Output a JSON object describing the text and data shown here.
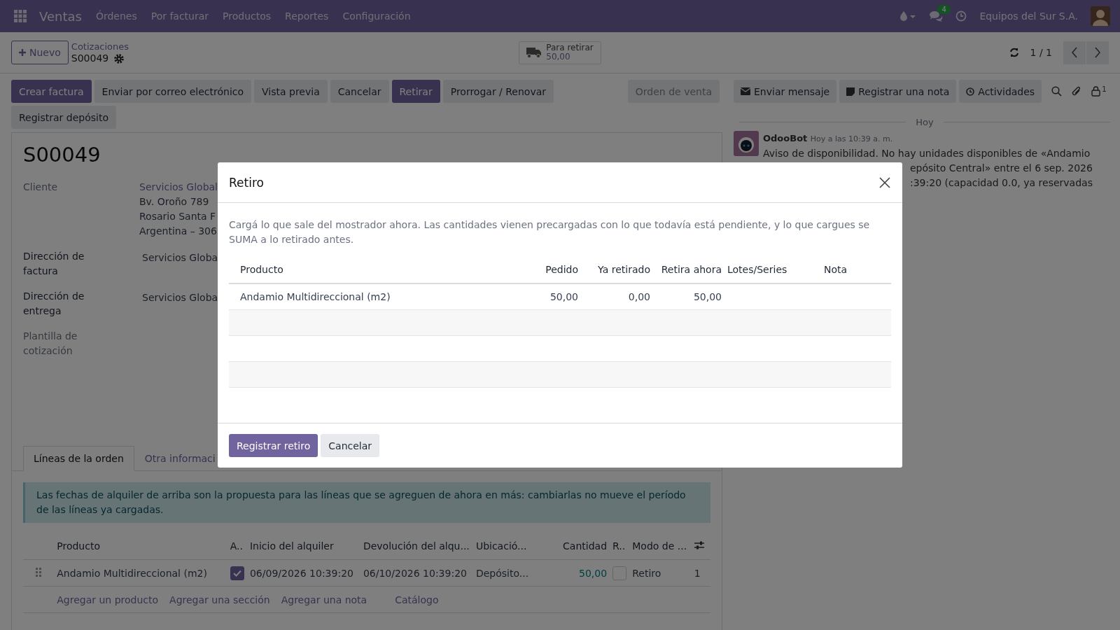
{
  "navbar": {
    "app": "Ventas",
    "menu": [
      "Órdenes",
      "Por facturar",
      "Productos",
      "Reportes",
      "Configuración"
    ],
    "messages_badge": "4",
    "company": "Equipos del Sur S.A."
  },
  "control_panel": {
    "new_button": "Nuevo",
    "breadcrumb": "Cotizaciones",
    "record": "S00049",
    "stat_button": {
      "label": "Para retirar",
      "value": "50,00"
    },
    "pager": "1 / 1"
  },
  "action_buttons": [
    {
      "label": "Crear factura",
      "kind": "primary"
    },
    {
      "label": "Enviar por correo electrónico",
      "kind": "secondary"
    },
    {
      "label": "Vista previa",
      "kind": "secondary"
    },
    {
      "label": "Cancelar",
      "kind": "secondary"
    },
    {
      "label": "Retirar",
      "kind": "primary"
    },
    {
      "label": "Prorrogar / Renovar",
      "kind": "secondary"
    },
    {
      "label": "Registrar depósito",
      "kind": "secondary"
    }
  ],
  "status_bar": {
    "stage": "Orden de venta"
  },
  "form": {
    "title": "S00049",
    "fields": [
      {
        "label": "Cliente",
        "strong": false,
        "lines": [
          {
            "text": "Servicios Global",
            "link": true
          },
          {
            "text": "Bv. Oroño 789",
            "link": false
          },
          {
            "text": "Rosario Santa F",
            "link": false
          },
          {
            "text": "Argentina – 306",
            "link": false
          }
        ]
      },
      {
        "label": "Dirección de factura",
        "strong": true,
        "lines": [
          {
            "text": "Servicios Globa",
            "link": false
          }
        ]
      },
      {
        "label": "Dirección de entrega",
        "strong": true,
        "lines": [
          {
            "text": "Servicios Globa",
            "link": false
          }
        ]
      },
      {
        "label": "Plantilla de cotización",
        "strong": false
      }
    ],
    "tabs": [
      {
        "label": "Líneas de la orden",
        "selected": true
      },
      {
        "label": "Otra informaci",
        "selected": false
      }
    ],
    "alert": "Las fechas de alquiler de arriba son la propuesta para las líneas que se agreguen de ahora en más: cambiarlas no mueve el período de las líneas ya cargadas.",
    "order_lines": {
      "columns": [
        "Producto",
        "A..",
        "Inicio del alquiler",
        "Devolución del alqu...",
        "Ubicació...",
        "Cantidad",
        "R..",
        "Modo de ..."
      ],
      "rows": [
        {
          "product": "Andamio Multidireccional (m2)",
          "a_checked": true,
          "start": "06/09/2026 10:39:20",
          "end": "06/10/2026 10:39:20",
          "location": "Depósito...",
          "quantity": "50,00",
          "r_checked": false,
          "mode": "Retiro",
          "column_9": "1"
        }
      ],
      "add_links": [
        "Agregar un producto",
        "Agregar una sección",
        "Agregar una nota",
        "Catálogo"
      ]
    }
  },
  "chatter": {
    "buttons": [
      "Enviar mensaje",
      "Registrar una nota",
      "Actividades"
    ],
    "followers": "1",
    "date_separator": "Hoy",
    "message": {
      "author": "OdooBot",
      "time": "Hoy a las 10:39 a. m.",
      "lines": [
        "Aviso de disponibilidad. No hay unidades disponibles de «Andamio",
        "epósito Central» entre el 6 sep. 2026",
        ":39:20 (capacidad 0.0, ya reservadas"
      ]
    }
  },
  "dialog": {
    "title": "Retiro",
    "description": "Cargá lo que sale del mostrador ahora. Las cantidades vienen precargadas con lo que todavía está pendiente, y lo que cargues se SUMA a lo retirado antes.",
    "columns": [
      "Producto",
      "Pedido",
      "Ya retirado",
      "Retira ahora",
      "Lotes/Series",
      "Nota"
    ],
    "rows": [
      {
        "product": "Andamio Multidireccional (m2)",
        "ordered": "50,00",
        "already": "0,00",
        "now": "50,00"
      }
    ],
    "buttons": [
      {
        "label": "Registrar retiro",
        "kind": "primary"
      },
      {
        "label": "Cancelar",
        "kind": "secondary"
      }
    ]
  }
}
